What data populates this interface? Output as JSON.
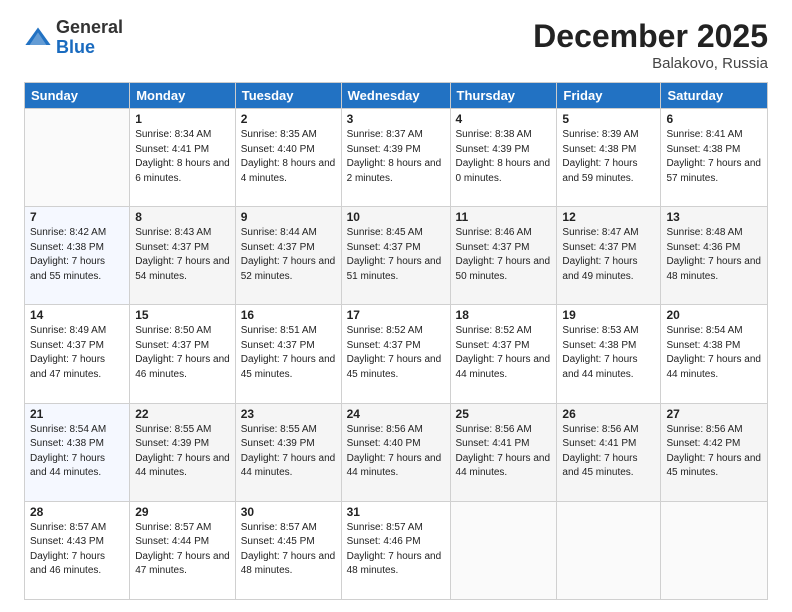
{
  "logo": {
    "general": "General",
    "blue": "Blue"
  },
  "header": {
    "month": "December 2025",
    "location": "Balakovo, Russia"
  },
  "weekdays": [
    "Sunday",
    "Monday",
    "Tuesday",
    "Wednesday",
    "Thursday",
    "Friday",
    "Saturday"
  ],
  "weeks": [
    [
      {
        "day": "",
        "sunrise": "",
        "sunset": "",
        "daylight": ""
      },
      {
        "day": "1",
        "sunrise": "Sunrise: 8:34 AM",
        "sunset": "Sunset: 4:41 PM",
        "daylight": "Daylight: 8 hours and 6 minutes."
      },
      {
        "day": "2",
        "sunrise": "Sunrise: 8:35 AM",
        "sunset": "Sunset: 4:40 PM",
        "daylight": "Daylight: 8 hours and 4 minutes."
      },
      {
        "day": "3",
        "sunrise": "Sunrise: 8:37 AM",
        "sunset": "Sunset: 4:39 PM",
        "daylight": "Daylight: 8 hours and 2 minutes."
      },
      {
        "day": "4",
        "sunrise": "Sunrise: 8:38 AM",
        "sunset": "Sunset: 4:39 PM",
        "daylight": "Daylight: 8 hours and 0 minutes."
      },
      {
        "day": "5",
        "sunrise": "Sunrise: 8:39 AM",
        "sunset": "Sunset: 4:38 PM",
        "daylight": "Daylight: 7 hours and 59 minutes."
      },
      {
        "day": "6",
        "sunrise": "Sunrise: 8:41 AM",
        "sunset": "Sunset: 4:38 PM",
        "daylight": "Daylight: 7 hours and 57 minutes."
      }
    ],
    [
      {
        "day": "7",
        "sunrise": "Sunrise: 8:42 AM",
        "sunset": "Sunset: 4:38 PM",
        "daylight": "Daylight: 7 hours and 55 minutes."
      },
      {
        "day": "8",
        "sunrise": "Sunrise: 8:43 AM",
        "sunset": "Sunset: 4:37 PM",
        "daylight": "Daylight: 7 hours and 54 minutes."
      },
      {
        "day": "9",
        "sunrise": "Sunrise: 8:44 AM",
        "sunset": "Sunset: 4:37 PM",
        "daylight": "Daylight: 7 hours and 52 minutes."
      },
      {
        "day": "10",
        "sunrise": "Sunrise: 8:45 AM",
        "sunset": "Sunset: 4:37 PM",
        "daylight": "Daylight: 7 hours and 51 minutes."
      },
      {
        "day": "11",
        "sunrise": "Sunrise: 8:46 AM",
        "sunset": "Sunset: 4:37 PM",
        "daylight": "Daylight: 7 hours and 50 minutes."
      },
      {
        "day": "12",
        "sunrise": "Sunrise: 8:47 AM",
        "sunset": "Sunset: 4:37 PM",
        "daylight": "Daylight: 7 hours and 49 minutes."
      },
      {
        "day": "13",
        "sunrise": "Sunrise: 8:48 AM",
        "sunset": "Sunset: 4:36 PM",
        "daylight": "Daylight: 7 hours and 48 minutes."
      }
    ],
    [
      {
        "day": "14",
        "sunrise": "Sunrise: 8:49 AM",
        "sunset": "Sunset: 4:37 PM",
        "daylight": "Daylight: 7 hours and 47 minutes."
      },
      {
        "day": "15",
        "sunrise": "Sunrise: 8:50 AM",
        "sunset": "Sunset: 4:37 PM",
        "daylight": "Daylight: 7 hours and 46 minutes."
      },
      {
        "day": "16",
        "sunrise": "Sunrise: 8:51 AM",
        "sunset": "Sunset: 4:37 PM",
        "daylight": "Daylight: 7 hours and 45 minutes."
      },
      {
        "day": "17",
        "sunrise": "Sunrise: 8:52 AM",
        "sunset": "Sunset: 4:37 PM",
        "daylight": "Daylight: 7 hours and 45 minutes."
      },
      {
        "day": "18",
        "sunrise": "Sunrise: 8:52 AM",
        "sunset": "Sunset: 4:37 PM",
        "daylight": "Daylight: 7 hours and 44 minutes."
      },
      {
        "day": "19",
        "sunrise": "Sunrise: 8:53 AM",
        "sunset": "Sunset: 4:38 PM",
        "daylight": "Daylight: 7 hours and 44 minutes."
      },
      {
        "day": "20",
        "sunrise": "Sunrise: 8:54 AM",
        "sunset": "Sunset: 4:38 PM",
        "daylight": "Daylight: 7 hours and 44 minutes."
      }
    ],
    [
      {
        "day": "21",
        "sunrise": "Sunrise: 8:54 AM",
        "sunset": "Sunset: 4:38 PM",
        "daylight": "Daylight: 7 hours and 44 minutes."
      },
      {
        "day": "22",
        "sunrise": "Sunrise: 8:55 AM",
        "sunset": "Sunset: 4:39 PM",
        "daylight": "Daylight: 7 hours and 44 minutes."
      },
      {
        "day": "23",
        "sunrise": "Sunrise: 8:55 AM",
        "sunset": "Sunset: 4:39 PM",
        "daylight": "Daylight: 7 hours and 44 minutes."
      },
      {
        "day": "24",
        "sunrise": "Sunrise: 8:56 AM",
        "sunset": "Sunset: 4:40 PM",
        "daylight": "Daylight: 7 hours and 44 minutes."
      },
      {
        "day": "25",
        "sunrise": "Sunrise: 8:56 AM",
        "sunset": "Sunset: 4:41 PM",
        "daylight": "Daylight: 7 hours and 44 minutes."
      },
      {
        "day": "26",
        "sunrise": "Sunrise: 8:56 AM",
        "sunset": "Sunset: 4:41 PM",
        "daylight": "Daylight: 7 hours and 45 minutes."
      },
      {
        "day": "27",
        "sunrise": "Sunrise: 8:56 AM",
        "sunset": "Sunset: 4:42 PM",
        "daylight": "Daylight: 7 hours and 45 minutes."
      }
    ],
    [
      {
        "day": "28",
        "sunrise": "Sunrise: 8:57 AM",
        "sunset": "Sunset: 4:43 PM",
        "daylight": "Daylight: 7 hours and 46 minutes."
      },
      {
        "day": "29",
        "sunrise": "Sunrise: 8:57 AM",
        "sunset": "Sunset: 4:44 PM",
        "daylight": "Daylight: 7 hours and 47 minutes."
      },
      {
        "day": "30",
        "sunrise": "Sunrise: 8:57 AM",
        "sunset": "Sunset: 4:45 PM",
        "daylight": "Daylight: 7 hours and 48 minutes."
      },
      {
        "day": "31",
        "sunrise": "Sunrise: 8:57 AM",
        "sunset": "Sunset: 4:46 PM",
        "daylight": "Daylight: 7 hours and 48 minutes."
      },
      {
        "day": "",
        "sunrise": "",
        "sunset": "",
        "daylight": ""
      },
      {
        "day": "",
        "sunrise": "",
        "sunset": "",
        "daylight": ""
      },
      {
        "day": "",
        "sunrise": "",
        "sunset": "",
        "daylight": ""
      }
    ]
  ]
}
